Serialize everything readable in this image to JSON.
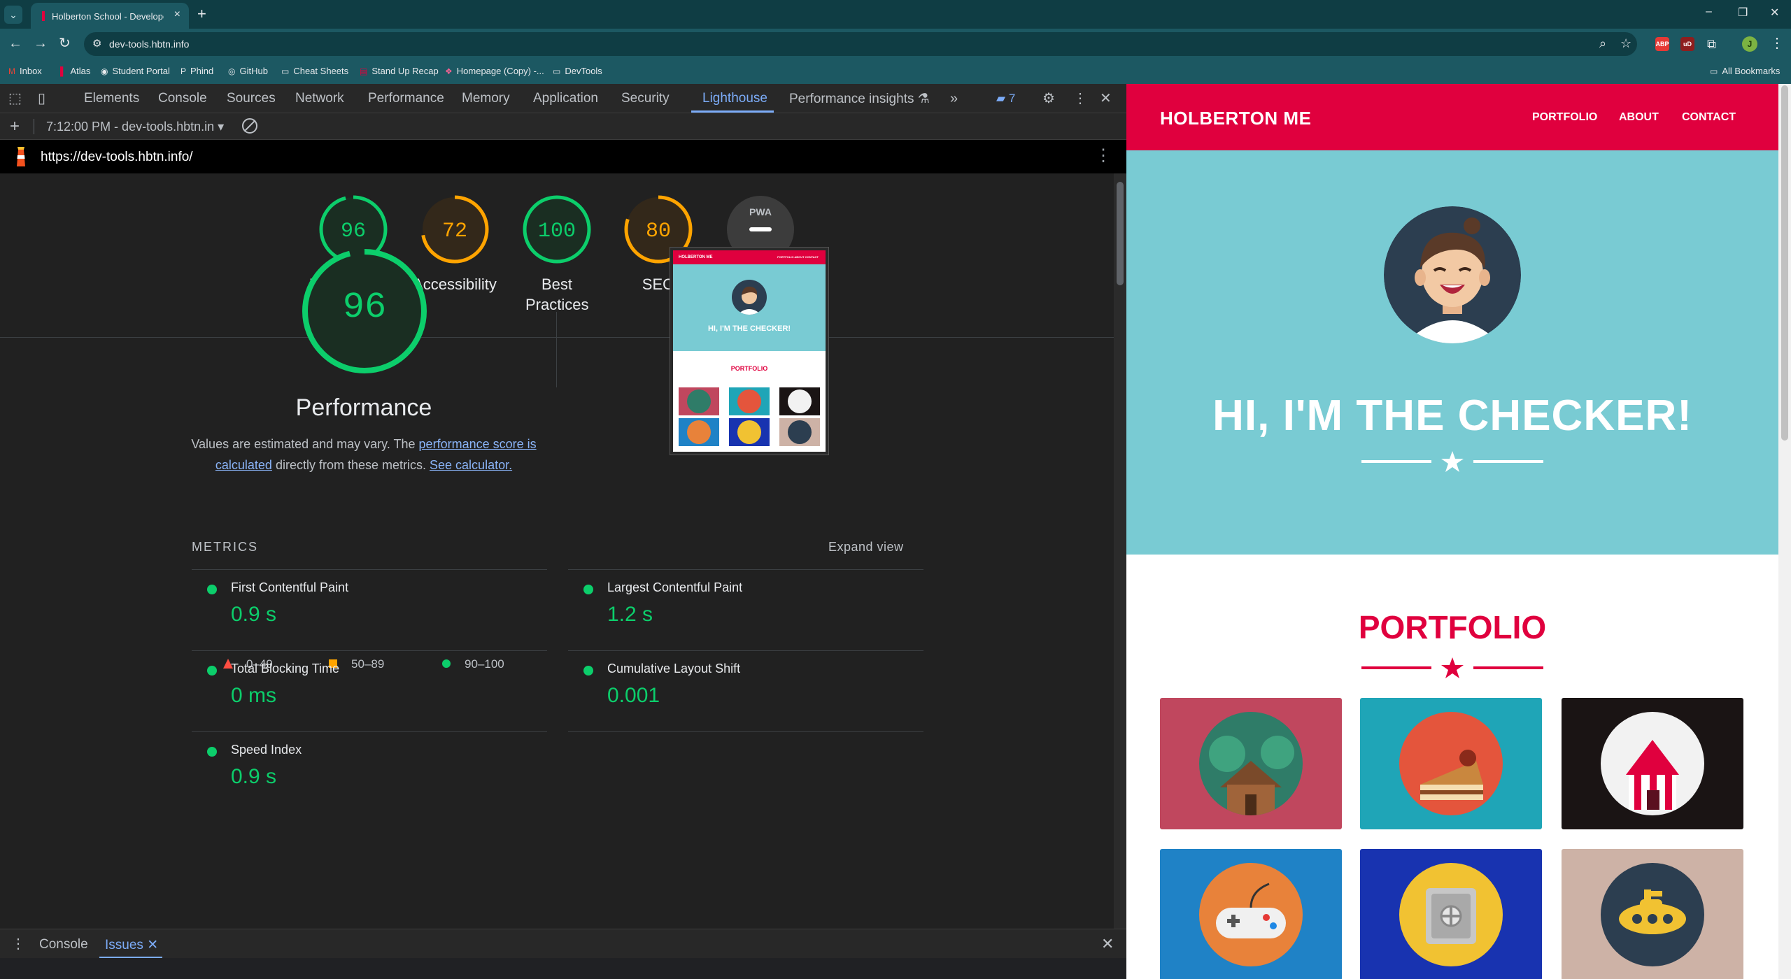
{
  "browser": {
    "tab_title": "Holberton School - Developer",
    "address": "dev-tools.hbtn.info",
    "bookmarks": [
      "Inbox",
      "Atlas",
      "Student Portal",
      "Phind",
      "GitHub",
      "Cheat Sheets",
      "Stand Up Recap",
      "Homepage (Copy) -...",
      "DevTools"
    ],
    "all_bookmarks": "All Bookmarks",
    "profile_initial": "J",
    "ext1": "ABP",
    "ext2": "uD"
  },
  "devtools": {
    "tabs": [
      "Elements",
      "Console",
      "Sources",
      "Network",
      "Performance",
      "Memory",
      "Application",
      "Security",
      "Lighthouse",
      "Performance insights"
    ],
    "active_tab": "Lighthouse",
    "issues_count": "7",
    "report_select": "7:12:00 PM - dev-tools.hbtn.in",
    "report_url": "https://dev-tools.hbtn.info/",
    "drawer_tabs": [
      "Console",
      "Issues"
    ],
    "drawer_active": "Issues"
  },
  "lighthouse": {
    "gauges": [
      {
        "label": "Performance",
        "score": 96,
        "color": "#0cce6b"
      },
      {
        "label": "Accessibility",
        "score": 72,
        "color": "#ffa400"
      },
      {
        "label": "Best Practices",
        "score": 100,
        "color": "#0cce6b"
      },
      {
        "label": "SEO",
        "score": 80,
        "color": "#ffa400"
      },
      {
        "label": "PWA",
        "score": null,
        "badge": "PWA"
      }
    ],
    "perf_score": "96",
    "perf_title": "Performance",
    "desc_pre": "Values are estimated and may vary. The ",
    "desc_link1": "performance score is calculated",
    "desc_mid": " directly from these metrics. ",
    "desc_link2": "See calculator.",
    "legend": [
      {
        "range": "0–49",
        "color": "#ff4e42",
        "shape": "triangle"
      },
      {
        "range": "50–89",
        "color": "#ffa400",
        "shape": "square"
      },
      {
        "range": "90–100",
        "color": "#0cce6b",
        "shape": "circle"
      }
    ],
    "metrics_heading": "METRICS",
    "expand_view": "Expand view",
    "metrics": [
      {
        "name": "First Contentful Paint",
        "value": "0.9 s"
      },
      {
        "name": "Largest Contentful Paint",
        "value": "1.2 s"
      },
      {
        "name": "Total Blocking Time",
        "value": "0 ms"
      },
      {
        "name": "Cumulative Layout Shift",
        "value": "0.001"
      },
      {
        "name": "Speed Index",
        "value": "0.9 s"
      }
    ],
    "thumb": {
      "logo": "HOLBERTON ME",
      "nav": "PORTFOLIO ABOUT CONTACT",
      "hero": "HI, I'M THE CHECKER!",
      "portfolio": "PORTFOLIO"
    }
  },
  "site": {
    "logo": "HOLBERTON ME",
    "nav": [
      "PORTFOLIO",
      "ABOUT",
      "CONTACT"
    ],
    "hero_title": "HI, I'M THE CHECKER!",
    "portfolio_title": "PORTFOLIO",
    "tiles": [
      {
        "name": "cabin",
        "bg": "#c0475e",
        "circle": "#2f7c68"
      },
      {
        "name": "cake",
        "bg": "#1fa5b7",
        "circle": "#e4553c"
      },
      {
        "name": "circus",
        "bg": "#1a1414",
        "circle": "#f2f2f2"
      },
      {
        "name": "game-controller",
        "bg": "#1f82c6",
        "circle": "#e8823a"
      },
      {
        "name": "safe",
        "bg": "#1833b0",
        "circle": "#f1c232"
      },
      {
        "name": "submarine",
        "bg": "#cdb2a6",
        "circle": "#2c3e50"
      }
    ]
  }
}
